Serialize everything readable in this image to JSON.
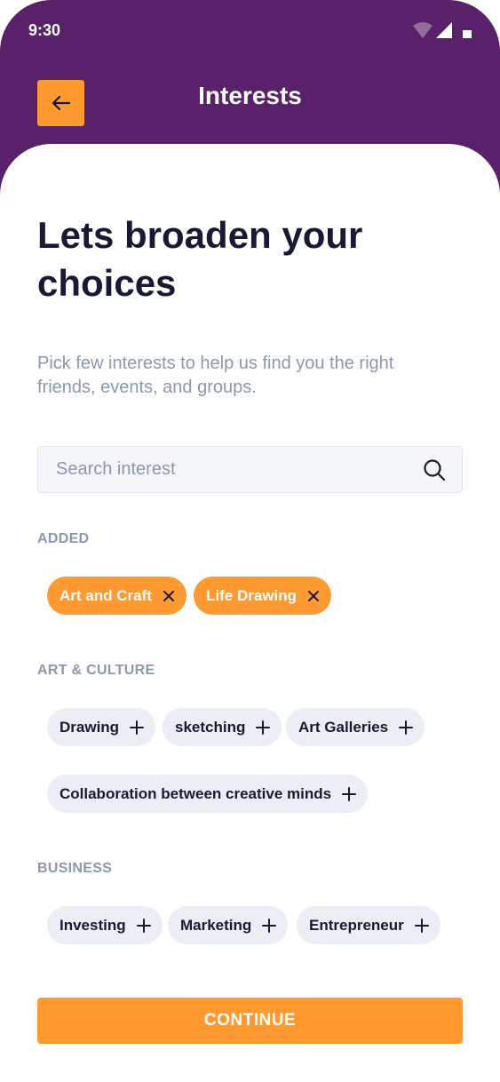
{
  "status_bar": {
    "time": "9:30"
  },
  "header": {
    "title": "Interests",
    "back_icon": "arrow-left-icon"
  },
  "main": {
    "headline": "Lets broaden your choices",
    "subtext": "Pick few interests to help us find you the right friends, events, and groups."
  },
  "search": {
    "placeholder": "Search interest",
    "value": ""
  },
  "sections": {
    "added": {
      "label": "ADDED",
      "items": [
        {
          "label": "Art and Craft"
        },
        {
          "label": "Life Drawing"
        }
      ]
    },
    "art_culture": {
      "label": "ART & CULTURE",
      "items": [
        {
          "label": "Drawing"
        },
        {
          "label": "sketching"
        },
        {
          "label": "Art Galleries"
        },
        {
          "label": "Collaboration between creative minds"
        }
      ]
    },
    "business": {
      "label": "BUSINESS",
      "items": [
        {
          "label": "Investing"
        },
        {
          "label": "Marketing"
        },
        {
          "label": "Entrepreneur"
        }
      ]
    }
  },
  "footer": {
    "continue_label": "CONTINUE"
  },
  "colors": {
    "header_bg": "#582169",
    "accent": "#ff9932",
    "chip_bg": "#eceef5",
    "text_dark": "#181a35",
    "text_muted": "#8d97ad"
  }
}
